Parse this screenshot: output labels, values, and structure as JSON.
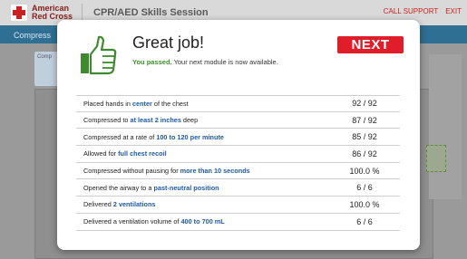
{
  "header": {
    "logo_line1": "American",
    "logo_line2": "Red Cross",
    "title": "CPR/AED Skills Session",
    "call_support": "CALL SUPPORT",
    "exit": "EXIT"
  },
  "strip": {
    "label": "Compress"
  },
  "background": {
    "card_text": "Comp"
  },
  "modal": {
    "heading": "Great job!",
    "passed": "You passed.",
    "message": " Your next module is now available.",
    "next_label": "NEXT"
  },
  "results": [
    {
      "pre": "Placed hands in ",
      "hl": "center",
      "post": " of the chest",
      "score": "92 / 92"
    },
    {
      "pre": "Compressed to ",
      "hl": "at least 2 inches",
      "post": " deep",
      "score": "87 / 92"
    },
    {
      "pre": "Compressed at a rate of ",
      "hl": "100 to 120 per minute",
      "post": "",
      "score": "85 / 92"
    },
    {
      "pre": "Allowed for ",
      "hl": "full chest recoil",
      "post": "",
      "score": "86 / 92"
    },
    {
      "pre": "Compressed without pausing for ",
      "hl": "more than 10 seconds",
      "post": "",
      "score": "100.0 %"
    },
    {
      "pre": "Opened the airway to a ",
      "hl": "past-neutral position",
      "post": "",
      "score": "6 / 6"
    },
    {
      "pre": "Delivered ",
      "hl": "2 ventilations",
      "post": "",
      "score": "100.0 %"
    },
    {
      "pre": "Delivered a ventilation volume of ",
      "hl": "400 to 700 mL",
      "post": "",
      "score": "6 / 6"
    }
  ],
  "colors": {
    "accent_red": "#e01e2a",
    "pass_green": "#3a8f2a",
    "highlight_blue": "#1f5aa6",
    "strip_blue": "#2f6f94"
  },
  "icons": {
    "thumb": "thumbs-up-icon",
    "logo": "red-cross-icon"
  }
}
